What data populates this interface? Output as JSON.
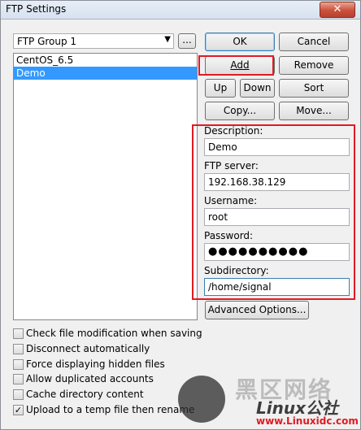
{
  "window": {
    "title": "FTP Settings",
    "close_glyph": "✕"
  },
  "group_select": {
    "value": "FTP Group 1",
    "arrow": "▼"
  },
  "ellipsis_label": "...",
  "buttons": {
    "ok": "OK",
    "cancel": "Cancel",
    "add": "Add",
    "remove": "Remove",
    "up": "Up",
    "down": "Down",
    "sort": "Sort",
    "copy": "Copy...",
    "move": "Move...",
    "advanced": "Advanced Options..."
  },
  "accounts": [
    {
      "label": "CentOS_6.5",
      "selected": false
    },
    {
      "label": "Demo",
      "selected": true
    }
  ],
  "fields": {
    "description": {
      "label": "Description:",
      "value": "Demo"
    },
    "ftp_server": {
      "label": "FTP server:",
      "value": "192.168.38.129"
    },
    "username": {
      "label": "Username:",
      "value": "root"
    },
    "password": {
      "label": "Password:",
      "value": "●●●●●●●●●●"
    },
    "subdirectory": {
      "label": "Subdirectory:",
      "value": "/home/signal"
    }
  },
  "options": [
    {
      "label": "Check file modification when saving",
      "checked": false
    },
    {
      "label": "Disconnect automatically",
      "checked": false
    },
    {
      "label": "Force displaying hidden files",
      "checked": false
    },
    {
      "label": "Allow duplicated accounts",
      "checked": false
    },
    {
      "label": "Cache directory content",
      "checked": false
    },
    {
      "label": "Upload to a temp file then rename",
      "checked": true
    }
  ],
  "watermark": {
    "text": "黑区网络",
    "brand": "Linux公社",
    "url": "www.Linuxidc.com"
  },
  "colors": {
    "highlight": "#e01a22",
    "selection": "#3399ff"
  }
}
